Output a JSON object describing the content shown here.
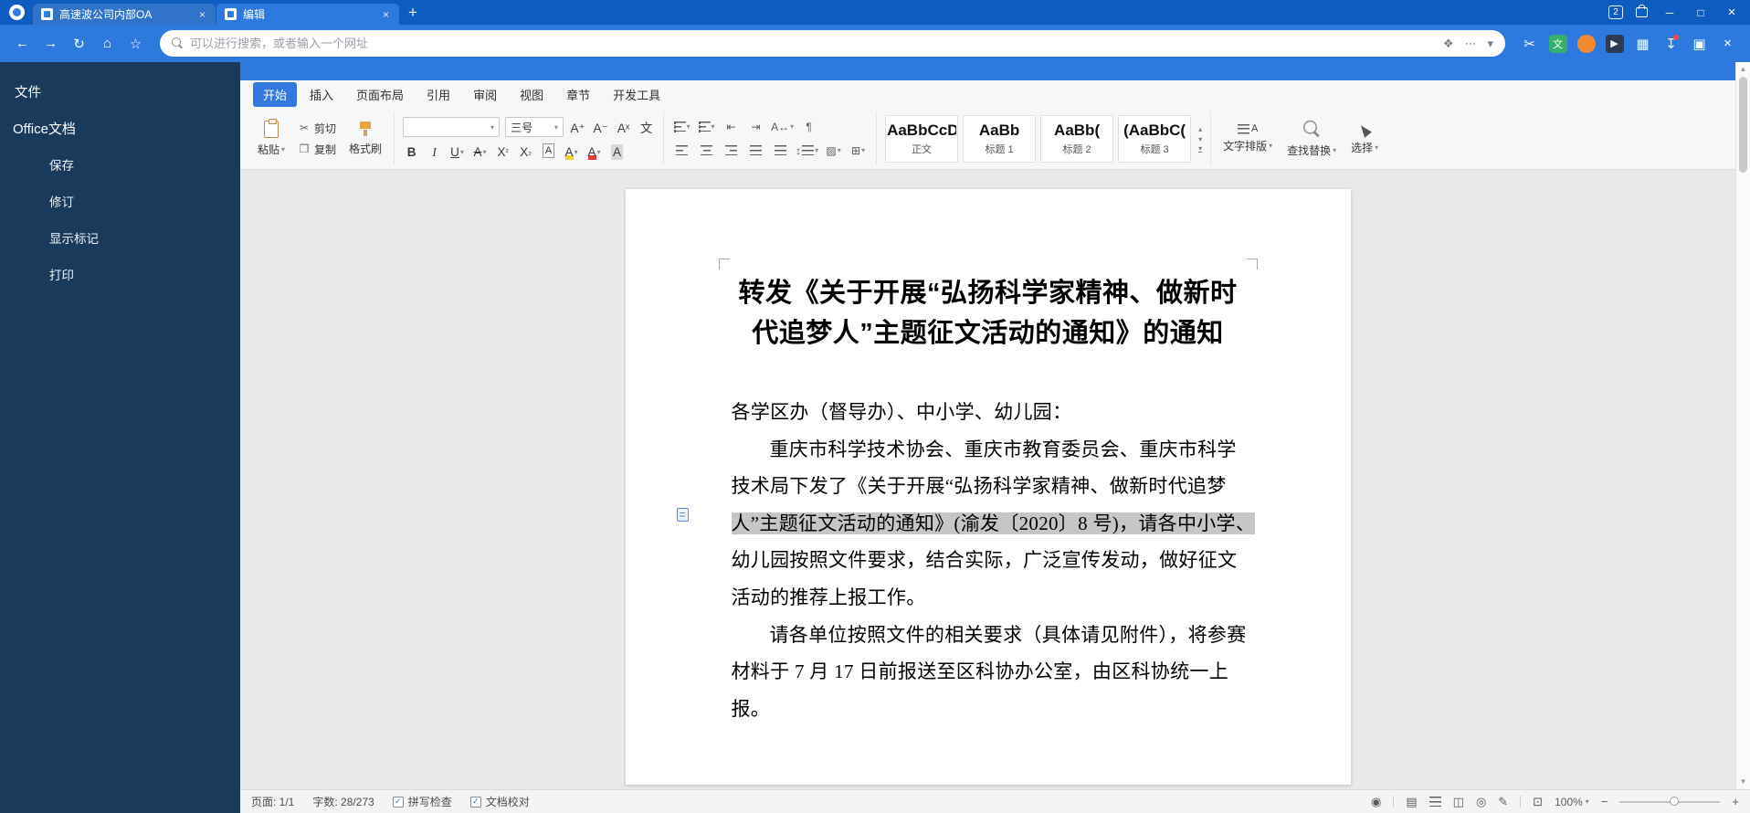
{
  "browser": {
    "tabs": [
      {
        "title": "高速波公司内部OA"
      },
      {
        "title": "编辑",
        "active": true
      }
    ],
    "badge": "2",
    "address_placeholder": "可以进行搜索，或者输入一个网址"
  },
  "icons": {
    "back": "←",
    "forward": "→",
    "refresh": "↻",
    "home": "⌂",
    "favorites": "☆",
    "new_tab": "+",
    "tab_close": "×",
    "window_min": "─",
    "window_max": "□",
    "window_close": "×",
    "more_dots": "⋯",
    "caret_down": "▾",
    "page_tools": "❖",
    "scissors": "✂",
    "play": "▶",
    "apps_grid": "▦",
    "download": "↧",
    "multi_window": "▣",
    "toolbar_close": "×",
    "copy_pages": "❐",
    "cn_char": "文",
    "grow_font": "A⁺",
    "shrink_font": "A⁻",
    "clear_format": "Aˣ",
    "outdent": "⇤",
    "indent": "⇥",
    "char_layout": "A↔",
    "para_mark": "¶",
    "line_spacing": "↕",
    "shading": "▨",
    "borders": "⊞",
    "gallery_up": "▴",
    "gallery_down": "▾",
    "scroll_up": "▲",
    "scroll_down": "▼",
    "check": "✓",
    "eye": "◉",
    "pencil": "✎",
    "page_view": "▤",
    "two_page": "◫",
    "web_view": "◎",
    "fit_page": "⊡",
    "minus": "−",
    "plus": "+",
    "sup": "²",
    "sub": "₂"
  },
  "sidebar": {
    "file_label": "文件",
    "section_label": "Office文档",
    "items": [
      {
        "label": "保存"
      },
      {
        "label": "修订"
      },
      {
        "label": "显示标记"
      },
      {
        "label": "打印"
      }
    ]
  },
  "ribbon": {
    "tabs": [
      {
        "label": "开始",
        "active": true
      },
      {
        "label": "插入"
      },
      {
        "label": "页面布局"
      },
      {
        "label": "引用"
      },
      {
        "label": "审阅"
      },
      {
        "label": "视图"
      },
      {
        "label": "章节"
      },
      {
        "label": "开发工具"
      }
    ],
    "paste_label": "粘贴",
    "cut_label": "剪切",
    "copy_label": "复制",
    "format_painter_label": "格式刷",
    "font_size_value": "三号",
    "format_buttons": {
      "bold": "B",
      "italic": "I",
      "underline": "U",
      "strike": "A",
      "sup_base": "X",
      "sub_base": "X",
      "border_a": "A",
      "highlight_a": "A",
      "color_a": "A",
      "shade_a": "A"
    },
    "styles": [
      {
        "preview": "AaBbCcDd",
        "name": "正文"
      },
      {
        "preview": "AaBb",
        "name": "标题 1"
      },
      {
        "preview": "AaBb(",
        "name": "标题 2"
      },
      {
        "preview": "(AaBbC(",
        "name": "标题 3"
      }
    ],
    "text_layout_label": "文字排版",
    "find_replace_label": "查找替换",
    "select_label": "选择"
  },
  "document": {
    "title_lines": [
      "转发《关于开展“弘扬科学家精神、做新时",
      "代追梦人”主题征文活动的通知》的通知"
    ],
    "lines": [
      {
        "text": "各学区办（督导办）、中小学、幼儿园："
      },
      {
        "text": "重庆市科学技术协会、重庆市教育委员会、重庆市科学",
        "indent": true
      },
      {
        "text": "技术局下发了《关于开展“弘扬科学家精神、做新时代追梦"
      },
      {
        "text": "人”主题征文活动的通知》(渝发〔2020〕8 号)，请各中小学、",
        "highlight": true
      },
      {
        "text": "幼儿园按照文件要求，结合实际，广泛宣传发动，做好征文"
      },
      {
        "text": "活动的推荐上报工作。"
      },
      {
        "text": "请各单位按照文件的相关要求（具体请见附件），将参赛",
        "indent": true
      },
      {
        "text": "材料于 7 月 17 日前报送至区科协办公室，由区科协统一上"
      },
      {
        "text": "报。"
      }
    ]
  },
  "statusbar": {
    "page_label": "页面: 1/1",
    "words_label": "字数: 28/273",
    "spellcheck_label": "拼写检查",
    "proofread_label": "文档校对",
    "zoom_value": "100%"
  },
  "colors": {
    "titlebar": "#0f5cc0",
    "toolbar": "#2e79dd",
    "sidebar": "#1a3a5c",
    "active_tab": "#3378de",
    "selection": "#c6c6c6"
  }
}
